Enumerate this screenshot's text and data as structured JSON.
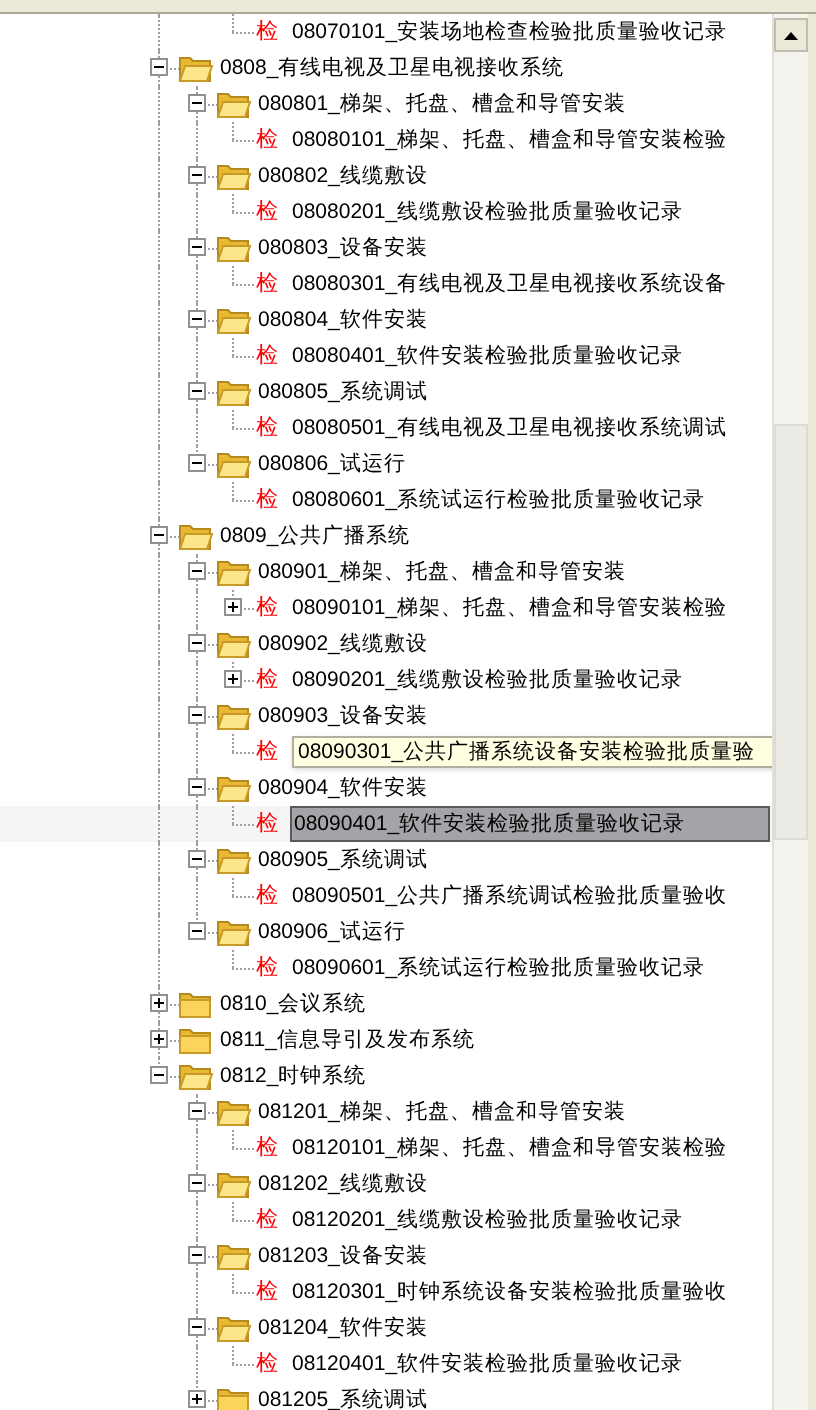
{
  "tree": [
    {
      "kind": "continued",
      "children": [
        {
          "kind": "continued",
          "children": [
            {
              "kind": "record",
              "tag": "检",
              "label": "08070101_安装场地检查检验批质量验收记录",
              "selected": false
            }
          ]
        }
      ]
    },
    {
      "kind": "folder",
      "label": "0808_有线电视及卫星电视接收系统",
      "expanded": true,
      "children": [
        {
          "kind": "folder",
          "label": "080801_梯架、托盘、槽盒和导管安装",
          "expanded": true,
          "children": [
            {
              "kind": "record",
              "tag": "检",
              "label": "08080101_梯架、托盘、槽盒和导管安装检验",
              "selected": false
            }
          ]
        },
        {
          "kind": "folder",
          "label": "080802_线缆敷设",
          "expanded": true,
          "children": [
            {
              "kind": "record",
              "tag": "检",
              "label": "08080201_线缆敷设检验批质量验收记录",
              "selected": false
            }
          ]
        },
        {
          "kind": "folder",
          "label": "080803_设备安装",
          "expanded": true,
          "children": [
            {
              "kind": "record",
              "tag": "检",
              "label": "08080301_有线电视及卫星电视接收系统设备",
              "selected": false
            }
          ]
        },
        {
          "kind": "folder",
          "label": "080804_软件安装",
          "expanded": true,
          "children": [
            {
              "kind": "record",
              "tag": "检",
              "label": "08080401_软件安装检验批质量验收记录",
              "selected": false
            }
          ]
        },
        {
          "kind": "folder",
          "label": "080805_系统调试",
          "expanded": true,
          "children": [
            {
              "kind": "record",
              "tag": "检",
              "label": "08080501_有线电视及卫星电视接收系统调试",
              "selected": false
            }
          ]
        },
        {
          "kind": "folder",
          "label": "080806_试运行",
          "expanded": true,
          "children": [
            {
              "kind": "record",
              "tag": "检",
              "label": "08080601_系统试运行检验批质量验收记录",
              "selected": false
            }
          ]
        }
      ]
    },
    {
      "kind": "folder",
      "label": "0809_公共广播系统",
      "expanded": true,
      "children": [
        {
          "kind": "folder",
          "label": "080901_梯架、托盘、槽盒和导管安装",
          "expanded": true,
          "children": [
            {
              "kind": "record-group",
              "tag": "检",
              "label": "08090101_梯架、托盘、槽盒和导管安装检验",
              "selected": false
            }
          ]
        },
        {
          "kind": "folder",
          "label": "080902_线缆敷设",
          "expanded": true,
          "children": [
            {
              "kind": "record-group",
              "tag": "检",
              "label": "08090201_线缆敷设检验批质量验收记录",
              "selected": false
            }
          ]
        },
        {
          "kind": "folder",
          "label": "080903_设备安装",
          "expanded": true,
          "children": [
            {
              "kind": "record",
              "tag": "检",
              "tooltip": "08090301_公共广播系统设备安装检验批质量验",
              "selected": false
            }
          ]
        },
        {
          "kind": "folder",
          "label": "080904_软件安装",
          "expanded": true,
          "children": [
            {
              "kind": "record",
              "tag": "检",
              "label": "08090401_软件安装检验批质量验收记录",
              "selected": true
            }
          ]
        },
        {
          "kind": "folder",
          "label": "080905_系统调试",
          "expanded": true,
          "children": [
            {
              "kind": "record",
              "tag": "检",
              "label": "08090501_公共广播系统调试检验批质量验收",
              "selected": false
            }
          ]
        },
        {
          "kind": "folder",
          "label": "080906_试运行",
          "expanded": true,
          "children": [
            {
              "kind": "record",
              "tag": "检",
              "label": "08090601_系统试运行检验批质量验收记录",
              "selected": false
            }
          ]
        }
      ]
    },
    {
      "kind": "folder",
      "label": "0810_会议系统",
      "expanded": false
    },
    {
      "kind": "folder",
      "label": "0811_信息导引及发布系统",
      "expanded": false
    },
    {
      "kind": "folder",
      "label": "0812_时钟系统",
      "expanded": true,
      "children": [
        {
          "kind": "folder",
          "label": "081201_梯架、托盘、槽盒和导管安装",
          "expanded": true,
          "children": [
            {
              "kind": "record",
              "tag": "检",
              "label": "08120101_梯架、托盘、槽盒和导管安装检验",
              "selected": false
            }
          ]
        },
        {
          "kind": "folder",
          "label": "081202_线缆敷设",
          "expanded": true,
          "children": [
            {
              "kind": "record",
              "tag": "检",
              "label": "08120201_线缆敷设检验批质量验收记录",
              "selected": false
            }
          ]
        },
        {
          "kind": "folder",
          "label": "081203_设备安装",
          "expanded": true,
          "children": [
            {
              "kind": "record",
              "tag": "检",
              "label": "08120301_时钟系统设备安装检验批质量验收",
              "selected": false
            }
          ]
        },
        {
          "kind": "folder",
          "label": "081204_软件安装",
          "expanded": true,
          "children": [
            {
              "kind": "record",
              "tag": "检",
              "label": "08120401_软件安装检验批质量验收记录",
              "selected": false
            }
          ]
        },
        {
          "kind": "folder",
          "label": "081205_系统调试",
          "expanded": false
        }
      ]
    }
  ]
}
